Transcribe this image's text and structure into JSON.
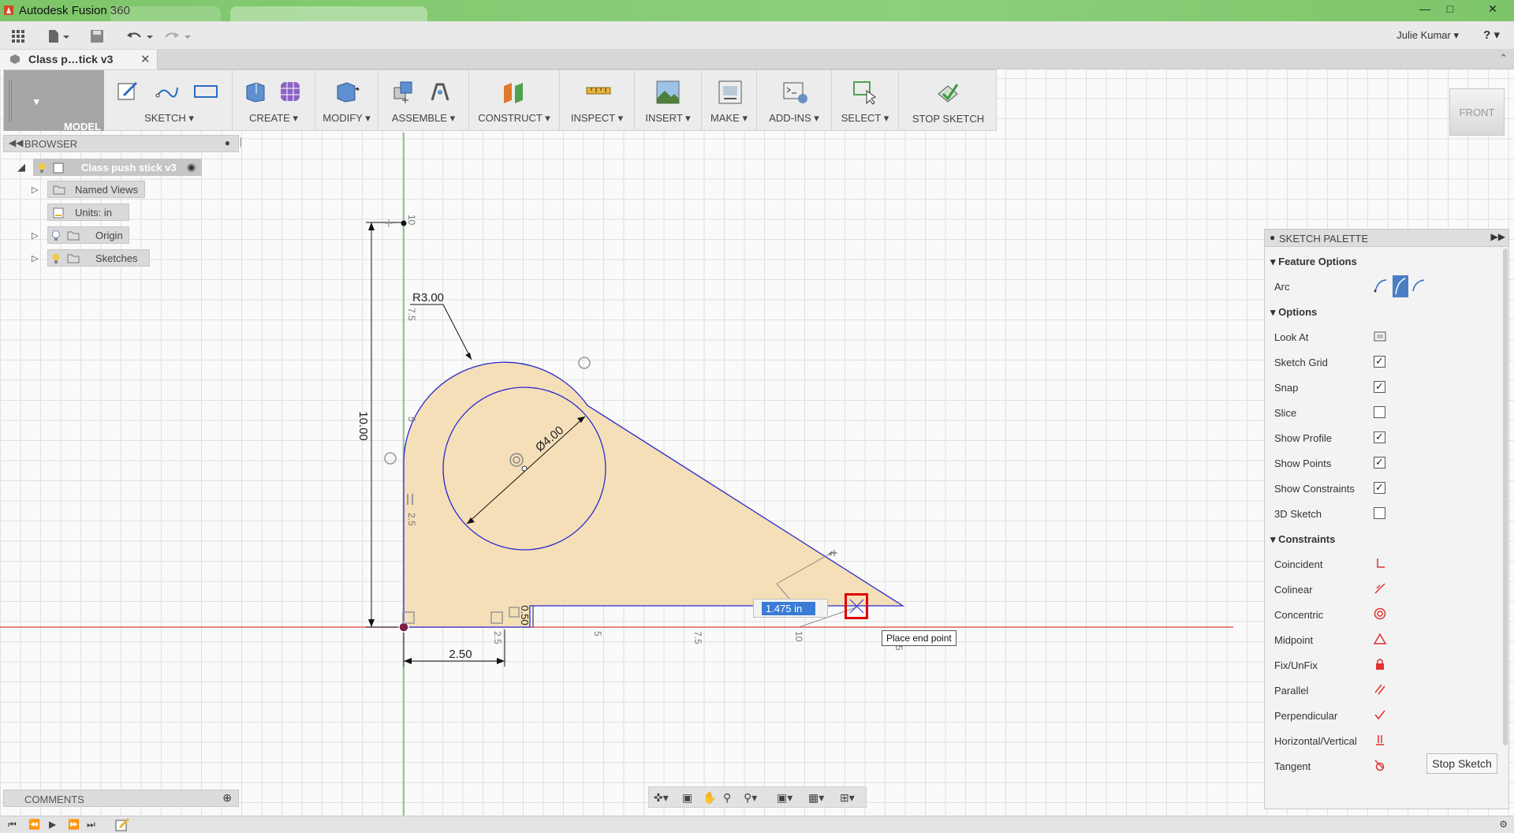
{
  "window": {
    "title": "Autodesk Fusion 360",
    "controls": [
      "minimize",
      "maximize",
      "close"
    ]
  },
  "qat": {
    "user": "Julie Kumar",
    "help": "?"
  },
  "document_tab": {
    "title": "Class p…tick v3"
  },
  "ribbon": {
    "workspace": "MODEL",
    "groups": {
      "sketch": "SKETCH",
      "create": "CREATE",
      "modify": "MODIFY",
      "assemble": "ASSEMBLE",
      "construct": "CONSTRUCT",
      "inspect": "INSPECT",
      "insert": "INSERT",
      "make": "MAKE",
      "addins": "ADD-INS",
      "select": "SELECT",
      "stop_sketch": "STOP SKETCH"
    }
  },
  "browser": {
    "title": "BROWSER",
    "root": "Class push stick v3",
    "items": {
      "named_views": "Named Views",
      "units": "Units: in",
      "origin": "Origin",
      "sketches": "Sketches"
    }
  },
  "comments": {
    "title": "COMMENTS"
  },
  "viewcube": {
    "face": "FRONT"
  },
  "sketch": {
    "dims": {
      "radius": "R3.00",
      "height": "10.00",
      "diameter": "Ø4.00",
      "width": "2.50",
      "step": "0.50"
    },
    "axis_ticks": {
      "vertical": [
        "10",
        "7.5",
        "5",
        "2.5"
      ],
      "horizontal": [
        "2.5",
        "5",
        "7.5",
        "10",
        "5"
      ]
    },
    "input_value": "1.475 in",
    "tooltip": "Place end point"
  },
  "palette": {
    "title": "SKETCH PALETTE",
    "feature_options": {
      "title": "Feature Options",
      "arc": "Arc"
    },
    "options": {
      "title": "Options",
      "look_at": "Look At",
      "items": [
        {
          "label": "Sketch Grid",
          "checked": true
        },
        {
          "label": "Snap",
          "checked": true
        },
        {
          "label": "Slice",
          "checked": false
        },
        {
          "label": "Show Profile",
          "checked": true
        },
        {
          "label": "Show Points",
          "checked": true
        },
        {
          "label": "Show Constraints",
          "checked": true
        },
        {
          "label": "3D Sketch",
          "checked": false
        }
      ]
    },
    "constraints": {
      "title": "Constraints",
      "items": [
        {
          "label": "Coincident",
          "icon": "coincident-icon"
        },
        {
          "label": "Colinear",
          "icon": "colinear-icon"
        },
        {
          "label": "Concentric",
          "icon": "concentric-icon"
        },
        {
          "label": "Midpoint",
          "icon": "midpoint-icon"
        },
        {
          "label": "Fix/UnFix",
          "icon": "lock-icon"
        },
        {
          "label": "Parallel",
          "icon": "parallel-icon"
        },
        {
          "label": "Perpendicular",
          "icon": "perpendicular-icon"
        },
        {
          "label": "Horizontal/Vertical",
          "icon": "horizontal-vertical-icon"
        },
        {
          "label": "Tangent",
          "icon": "tangent-icon"
        }
      ]
    },
    "stop_button": "Stop Sketch"
  },
  "colors": {
    "accent": "#3a7bd5",
    "profile_fill": "#f5dfb8",
    "sketch_line": "#2a2ad0",
    "axis_red": "#e04040",
    "axis_green": "#46b046",
    "constraint_red": "#e03030"
  }
}
